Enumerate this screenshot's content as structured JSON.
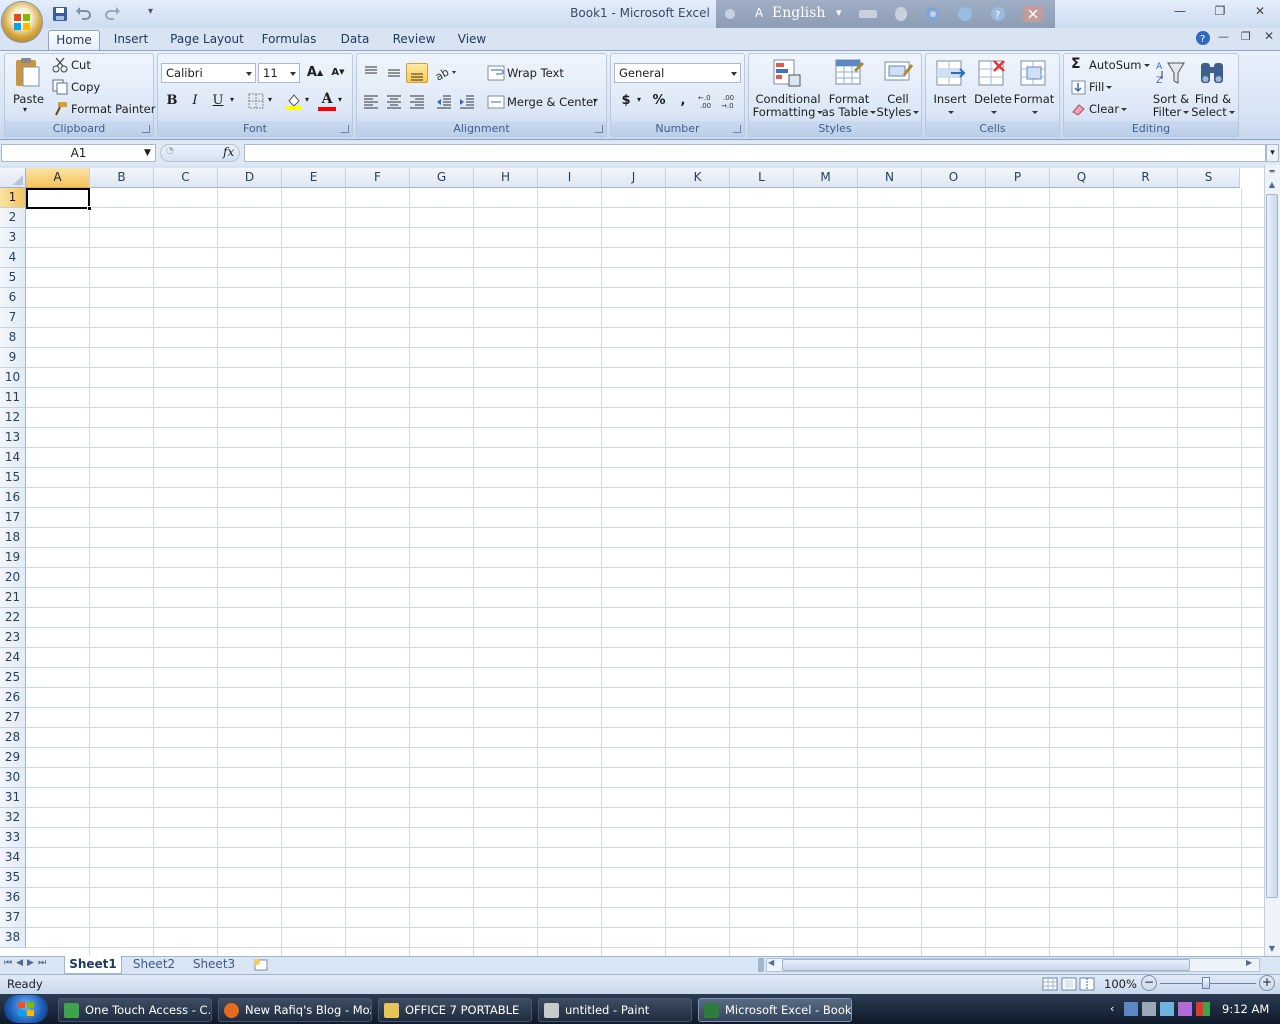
{
  "window": {
    "title": "Book1 - Microsoft Excel",
    "language_bar": "English"
  },
  "ribbon": {
    "tabs": [
      "Home",
      "Insert",
      "Page Layout",
      "Formulas",
      "Data",
      "Review",
      "View"
    ],
    "active_tab": "Home",
    "clipboard": {
      "label": "Clipboard",
      "paste": "Paste",
      "cut": "Cut",
      "copy": "Copy",
      "format_painter": "Format Painter"
    },
    "font": {
      "label": "Font",
      "name": "Calibri",
      "size": "11",
      "bold": "B",
      "italic": "I",
      "underline": "U",
      "font_color_glyph": "A"
    },
    "alignment": {
      "label": "Alignment",
      "wrap_text": "Wrap Text",
      "merge_center": "Merge & Center"
    },
    "number": {
      "label": "Number",
      "format": "General",
      "currency": "$",
      "percent": "%",
      "comma": ","
    },
    "styles": {
      "label": "Styles",
      "conditional_1": "Conditional",
      "conditional_2": "Formatting",
      "format_table_1": "Format",
      "format_table_2": "as Table",
      "cell_styles_1": "Cell",
      "cell_styles_2": "Styles"
    },
    "cells": {
      "label": "Cells",
      "insert": "Insert",
      "delete": "Delete",
      "format": "Format"
    },
    "editing": {
      "label": "Editing",
      "autosum": "AutoSum",
      "fill": "Fill",
      "clear": "Clear",
      "sort_1": "Sort &",
      "sort_2": "Filter",
      "find_1": "Find &",
      "find_2": "Select"
    }
  },
  "formula_bar": {
    "name_box": "A1",
    "fx": "fx",
    "content": ""
  },
  "grid": {
    "columns": [
      "A",
      "B",
      "C",
      "D",
      "E",
      "F",
      "G",
      "H",
      "I",
      "J",
      "K",
      "L",
      "M",
      "N",
      "O",
      "P",
      "Q",
      "R",
      "S"
    ],
    "rows": [
      "1",
      "2",
      "3",
      "4",
      "5",
      "6",
      "7",
      "8",
      "9",
      "10",
      "11",
      "12",
      "13",
      "14",
      "15",
      "16",
      "17",
      "18",
      "19",
      "20",
      "21",
      "22",
      "23",
      "24",
      "25",
      "26",
      "27",
      "28",
      "29",
      "30",
      "31",
      "32",
      "33",
      "34",
      "35",
      "36",
      "37",
      "38"
    ],
    "active_cell": "A1"
  },
  "sheets": {
    "tabs": [
      "Sheet1",
      "Sheet2",
      "Sheet3"
    ],
    "active": "Sheet1"
  },
  "status": {
    "text": "Ready",
    "zoom": "100%"
  },
  "taskbar": {
    "items": [
      "One Touch Access - C...",
      "New Rafiq's Blog - Moz...",
      "OFFICE 7 PORTABLE",
      "untitled - Paint",
      "Microsoft Excel - Book1"
    ],
    "active": "Microsoft Excel - Book1",
    "clock": "9:12 AM"
  }
}
